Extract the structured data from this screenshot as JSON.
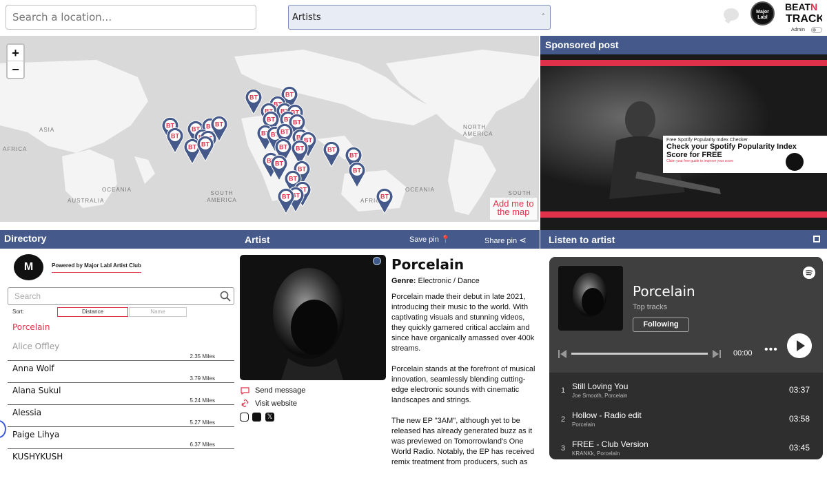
{
  "search": {
    "placeholder": "Search a location..."
  },
  "filter": {
    "selected": "Artists"
  },
  "header": {
    "logo_text": "Major Labl",
    "brand": "BEAT N TRACK",
    "admin_label": "Admin"
  },
  "map": {
    "zoom_in": "+",
    "zoom_out": "−",
    "labels": [
      "ASIA",
      "AFRICA",
      "NORTH AMERICA",
      "OCEANIA",
      "AUSTRALIA",
      "SOUTH AMERICA",
      "OCEANIA",
      "AFRICA",
      "SOUTH AMERICA"
    ],
    "pin_text": "BT",
    "add_me": "Add me to the map"
  },
  "sponsored": {
    "title": "Sponsored post",
    "small": "Free Spotify Popularity Index Checker",
    "headline": "Check your Spotify Popularity Index Score for FREE",
    "sub": "Claim your free guide to improve your score"
  },
  "directory": {
    "title": "Directory",
    "powered": "Powered by Major Labl Artist Club",
    "search_placeholder": "Search",
    "sort_label": "Sort:",
    "sort_distance": "Distance",
    "sort_name": "Name",
    "items": [
      {
        "name": "Porcelain",
        "miles": ""
      },
      {
        "name": "Alice Offley",
        "miles": "2.35 Miles"
      },
      {
        "name": "Anna Wolf",
        "miles": "3.79 Miles"
      },
      {
        "name": "Alana Sukul",
        "miles": "5.24 Miles"
      },
      {
        "name": "Alessia",
        "miles": "5.27 Miles"
      },
      {
        "name": "Paige Lihya",
        "miles": "6.37 Miles"
      },
      {
        "name": "KUSHYKUSH",
        "miles": ""
      }
    ]
  },
  "artist": {
    "section_title": "Artist",
    "save_pin": "Save pin",
    "share_pin": "Share pin",
    "name": "Porcelain",
    "genre_label": "Genre:",
    "genre_value": "Electronic / Dance",
    "send_message": "Send message",
    "visit_website": "Visit website",
    "bio": [
      "Porcelain made their debut in late 2021, introducing their music to the world. With captivating visuals and stunning videos, they quickly garnered critical acclaim and since have organically  amassed over 400k streams.",
      "Porcelain  stands at the forefront of musical innovation, seamlessly blending cutting-edge electronic sounds with cinematic landscapes and strings.",
      "The new EP \"3AM\", although yet to be released has already generated buzz as it was previewed on Tomorrowland's One World Radio. Notably, the EP has received remix treatment from producers, such as"
    ]
  },
  "listen": {
    "title": "Listen to artist",
    "artist": "Porcelain",
    "subtitle": "Top tracks",
    "follow": "Following",
    "time": "00:00",
    "more": "•••",
    "tracks": [
      {
        "num": "1",
        "title": "Still Loving You",
        "artists": "Joe Smooth, Porcelain",
        "dur": "03:37"
      },
      {
        "num": "2",
        "title": "Hollow - Radio edit",
        "artists": "Porcelain",
        "dur": "03:58"
      },
      {
        "num": "3",
        "title": "FREE - Club Version",
        "artists": "KRANKk, Porcelain",
        "dur": "03:45"
      }
    ]
  },
  "colors": {
    "accent": "#e0314a",
    "navy": "#455a8a",
    "pin": "#455a8a",
    "map_bg": "#d9d9d9"
  }
}
